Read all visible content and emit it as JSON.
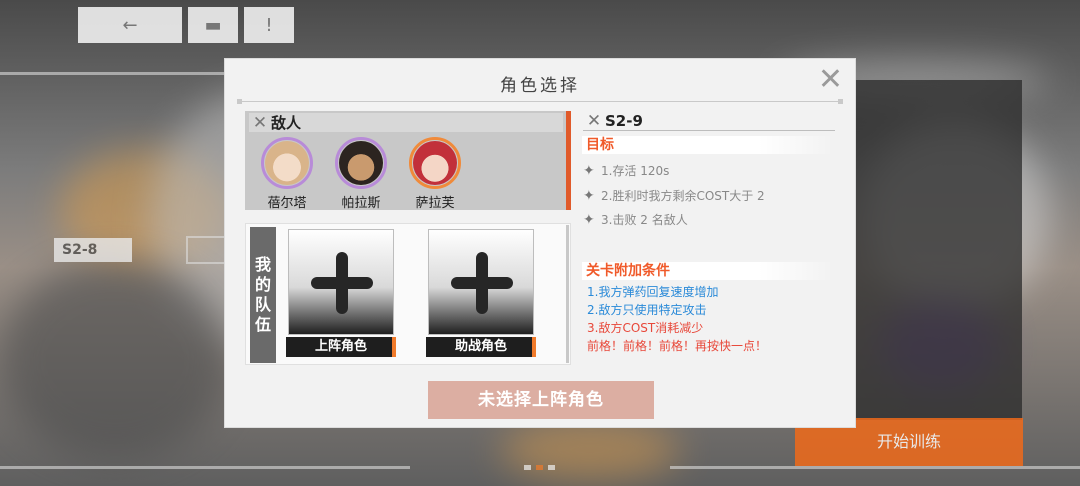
{
  "background": {
    "stage_tag": "S2-8",
    "right_button": "开始训练"
  },
  "topbar": {
    "back_icon": "←",
    "home_icon": "▬",
    "info_icon": "!"
  },
  "dialog": {
    "title": "角色选择",
    "close_icon": "✕",
    "enemy_panel": {
      "label": "敌人",
      "enemies": [
        {
          "name": "蓓尔塔"
        },
        {
          "name": "帕拉斯"
        },
        {
          "name": "萨拉芙"
        }
      ]
    },
    "team_panel": {
      "label_chars": [
        "我",
        "的",
        "队",
        "伍"
      ],
      "slots": [
        {
          "label": "上阵角色"
        },
        {
          "label": "助战角色"
        }
      ]
    },
    "stage": {
      "id": "S2-9",
      "objectives_title": "目标",
      "objectives": [
        "1.存活 120s",
        "2.胜利时我方剩余COST大于 2",
        "3.击败 2 名敌人"
      ],
      "extra_title": "关卡附加条件",
      "conditions": [
        "1.我方弹药回复速度增加",
        "2.敌方只使用特定攻击",
        "3.敌方COST消耗减少"
      ],
      "tagline": "前格！前格！前格！再按快一点！"
    },
    "confirm_label": "未选择上阵角色"
  }
}
